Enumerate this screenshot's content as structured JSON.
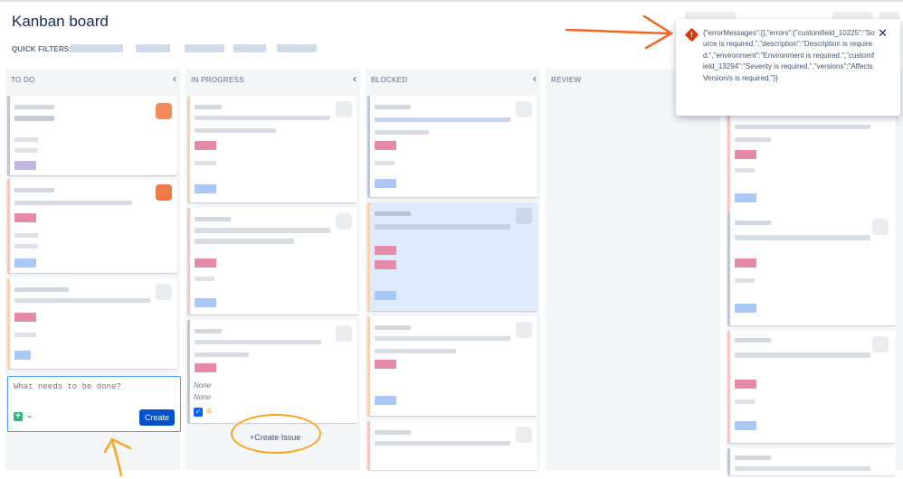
{
  "page": {
    "title": "Kanban board"
  },
  "quick_filters": {
    "label": "QUICK FILTERS:"
  },
  "columns": [
    {
      "name": "TO DO",
      "collapse_icon": "chevron-left-icon"
    },
    {
      "name": "IN PROGRESS",
      "collapse_icon": "chevron-left-icon"
    },
    {
      "name": "BLOCKED",
      "collapse_icon": "chevron-left-icon"
    },
    {
      "name": "REVIEW"
    }
  ],
  "inline_create": {
    "placeholder": "What needs to be done?",
    "issue_type_icon": "plus-square-icon",
    "create_label": "Create"
  },
  "in_progress_card": {
    "field_1": "None",
    "field_2": "None",
    "checkbox_icon": "checkbox-checked-icon",
    "priority_icon": "priority-medium-icon"
  },
  "create_issue": {
    "label": "Create Issue",
    "icon": "plus-icon"
  },
  "error_flag": {
    "icon": "error-icon",
    "message": "{\"errorMessages\":[],\"errors\":{\"customfield_10225\":\"Source is required.\",\"description\":\"Description is required.\",\"environment\":\"Environment is required.\",\"customfield_13294\":\"Severity is required.\",\"versions\":\"Affects Version/s is required.\"}}",
    "close_icon": "close-icon"
  },
  "annotation_colors": {
    "arrow": "#f26522",
    "circle": "#f5a623"
  }
}
